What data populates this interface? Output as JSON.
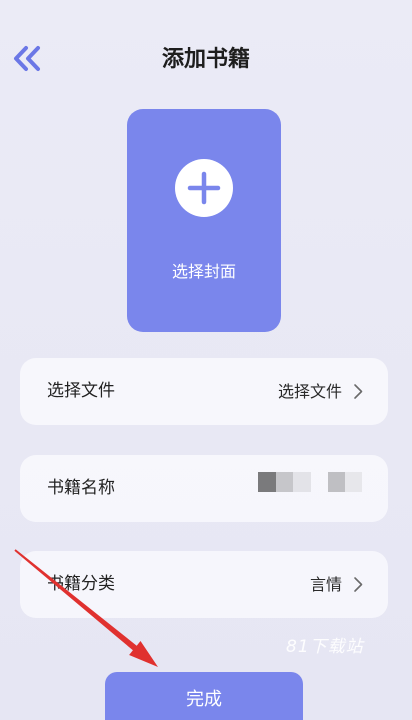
{
  "header": {
    "title": "添加书籍",
    "back_icon": "double-chevron-left-icon"
  },
  "cover": {
    "label": "选择封面",
    "icon": "plus-icon"
  },
  "form": {
    "rows": [
      {
        "label": "选择文件",
        "value": "选择文件",
        "icon": "chevron-right-icon"
      },
      {
        "label": "书籍名称"
      },
      {
        "label": "书籍分类",
        "value": "言情",
        "icon": "chevron-right-icon"
      }
    ]
  },
  "submit": {
    "label": "完成"
  },
  "watermark": {
    "text": "81下载站"
  },
  "colors": {
    "accent": "#7a86ec",
    "back_icon": "#6b77e6",
    "background": "#ebebf6",
    "annotation_arrow": "#e0312f"
  }
}
